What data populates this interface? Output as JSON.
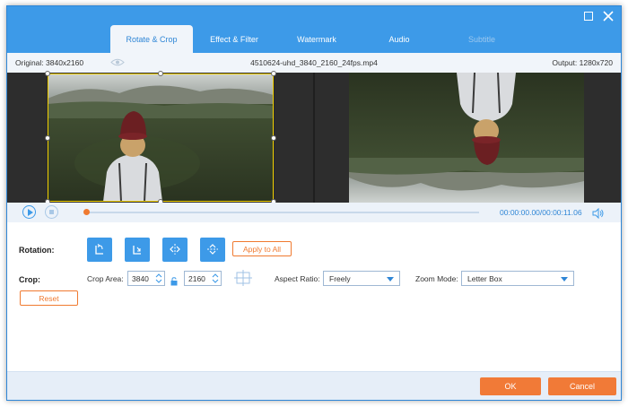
{
  "tabs": [
    {
      "label": "Rotate & Crop",
      "state": "active"
    },
    {
      "label": "Effect & Filter",
      "state": "normal"
    },
    {
      "label": "Watermark",
      "state": "normal"
    },
    {
      "label": "Audio",
      "state": "normal"
    },
    {
      "label": "Subtitle",
      "state": "disabled"
    }
  ],
  "info": {
    "original": "Original: 3840x2160",
    "filename": "4510624-uhd_3840_2160_24fps.mp4",
    "output": "Output: 1280x720"
  },
  "playback": {
    "current_time": "00:00:00.00",
    "total_time": "/00:00:11.06",
    "progress": 0.0
  },
  "rotation": {
    "label": "Rotation:",
    "buttons": [
      "rotate-left",
      "rotate-right",
      "flip-horizontal",
      "flip-vertical"
    ],
    "apply_label": "Apply to All"
  },
  "crop": {
    "label": "Crop:",
    "area_label": "Crop Area:",
    "width": "3840",
    "height": "2160",
    "aspect_label": "Aspect Ratio:",
    "aspect_value": "Freely",
    "zoom_label": "Zoom Mode:",
    "zoom_value": "Letter Box",
    "reset_label": "Reset"
  },
  "footer": {
    "ok_label": "OK",
    "cancel_label": "Cancel"
  },
  "colors": {
    "accent": "#3d9ae8",
    "orange": "#f17a37",
    "crop_frame": "#f2d000"
  }
}
